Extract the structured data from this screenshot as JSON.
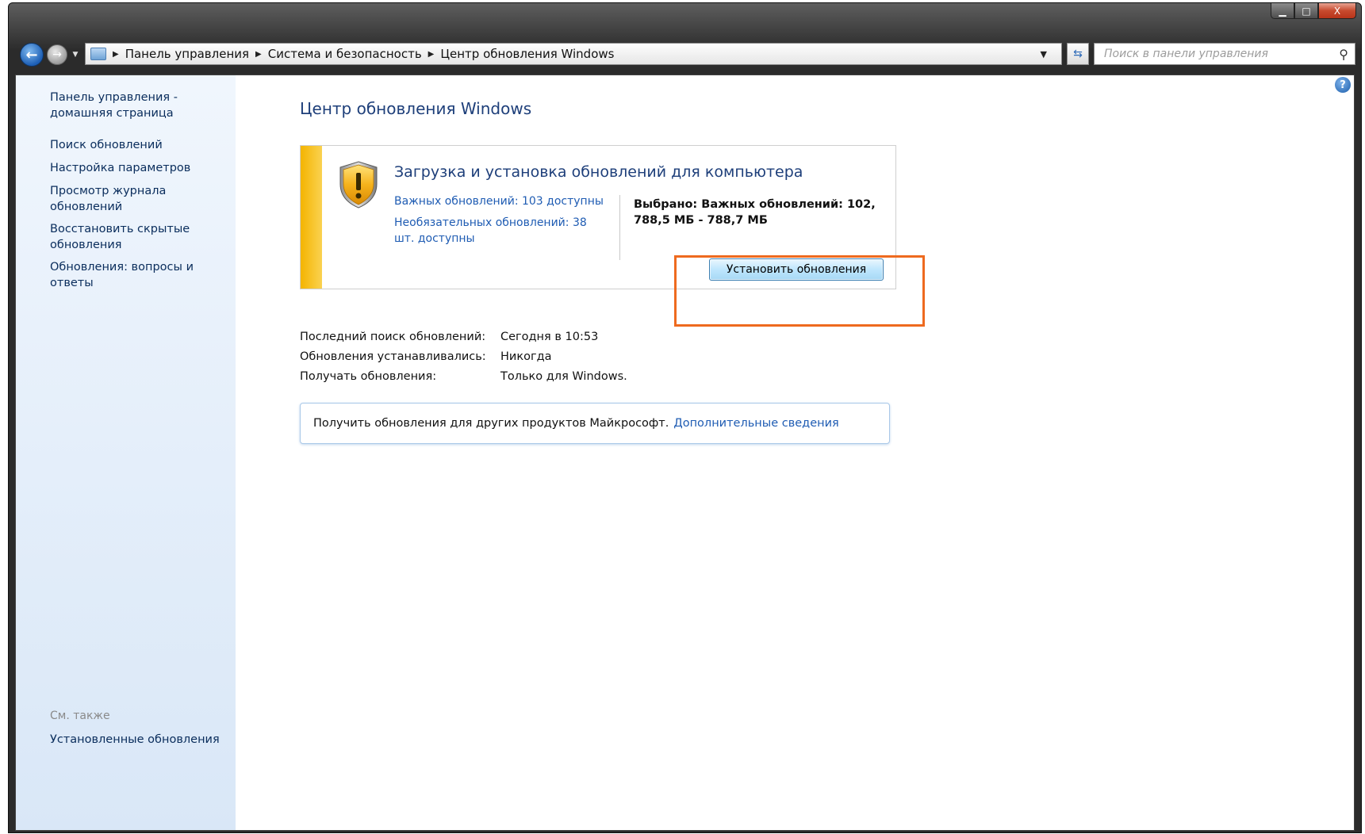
{
  "window": {
    "caption_buttons": {
      "minimize": "▁",
      "maximize": "□",
      "close": "X"
    }
  },
  "address_bar": {
    "crumbs": [
      "Панель управления",
      "Система и безопасность",
      "Центр обновления Windows"
    ],
    "search_placeholder": "Поиск в панели управления"
  },
  "sidebar": {
    "home_link": "Панель управления - домашняя страница",
    "links": [
      "Поиск обновлений",
      "Настройка параметров",
      "Просмотр журнала обновлений",
      "Восстановить скрытые обновления",
      "Обновления: вопросы и ответы"
    ],
    "see_also_heading": "См. также",
    "see_also_links": [
      "Установленные обновления"
    ]
  },
  "main": {
    "title": "Центр обновления Windows",
    "update_panel": {
      "title": "Загрузка и установка обновлений для компьютера",
      "important_link": "Важных обновлений: 103 доступны",
      "optional_link": "Необязательных обновлений: 38 шт. доступны",
      "selected_text": "Выбрано: Важных обновлений: 102, 788,5 МБ - 788,7 МБ",
      "install_button": "Установить обновления"
    },
    "info": [
      {
        "label": "Последний поиск обновлений:",
        "value": "Сегодня в 10:53"
      },
      {
        "label": "Обновления устанавливались:",
        "value": "Никогда"
      },
      {
        "label": "Получать обновления:",
        "value": "Только для Windows."
      }
    ],
    "promo": {
      "text": "Получить обновления для других продуктов Майкрософт.",
      "link": "Дополнительные сведения"
    }
  },
  "colors": {
    "highlight": "#ee6a1f",
    "stripe": "#f4b400",
    "link": "#1f5cb3",
    "title": "#1e3f7a"
  }
}
